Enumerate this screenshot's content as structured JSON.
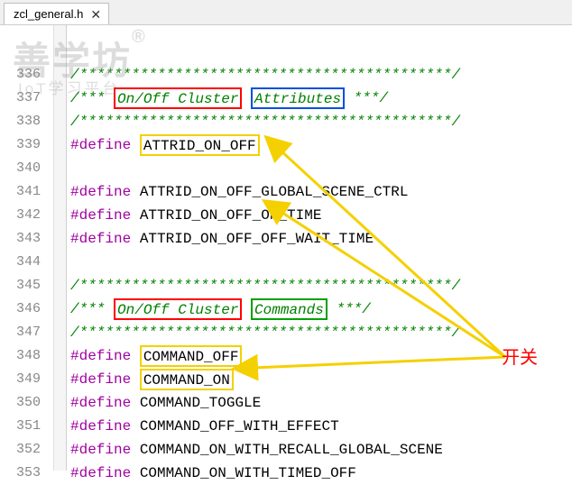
{
  "tab": {
    "filename": "zcl_general.h",
    "close": "✕"
  },
  "watermark": {
    "main": "善学坊",
    "reg": "®",
    "sub": "IoT学习平台"
  },
  "gutter": [
    "336",
    "337",
    "338",
    "339",
    "340",
    "341",
    "342",
    "343",
    "344",
    "345",
    "346",
    "347",
    "348",
    "349",
    "350",
    "351",
    "352",
    "353"
  ],
  "code": {
    "l336": "/*******************************************/",
    "l337_pre": "/*** ",
    "l337_red": "On/Off Cluster",
    "l337_blue": "Attributes",
    "l337_post": " ***/",
    "l338": "/*******************************************/",
    "l339_kw": "#define",
    "l339_id": "ATTRID_ON_OFF",
    "l341_kw": "#define",
    "l341_id": "ATTRID_ON_OFF_GLOBAL_SCENE_CTRL",
    "l342_kw": "#define",
    "l342_id": "ATTRID_ON_OFF_ON_TIME",
    "l343_kw": "#define",
    "l343_id": "ATTRID_ON_OFF_OFF_WAIT_TIME",
    "l345": "/*******************************************/",
    "l346_pre": "/*** ",
    "l346_red": "On/Off Cluster",
    "l346_green": "Commands",
    "l346_post": " ***/",
    "l347": "/*******************************************/",
    "l348_kw": "#define",
    "l348_id": "COMMAND_OFF",
    "l349_kw": "#define",
    "l349_id": "COMMAND_ON",
    "l350_kw": "#define",
    "l350_id": "COMMAND_TOGGLE",
    "l351_kw": "#define",
    "l351_id": "COMMAND_OFF_WITH_EFFECT",
    "l352_kw": "#define",
    "l352_id": "COMMAND_ON_WITH_RECALL_GLOBAL_SCENE",
    "l353_kw": "#define",
    "l353_id": "COMMAND_ON_WITH_TIMED_OFF"
  },
  "annotation": "开关"
}
